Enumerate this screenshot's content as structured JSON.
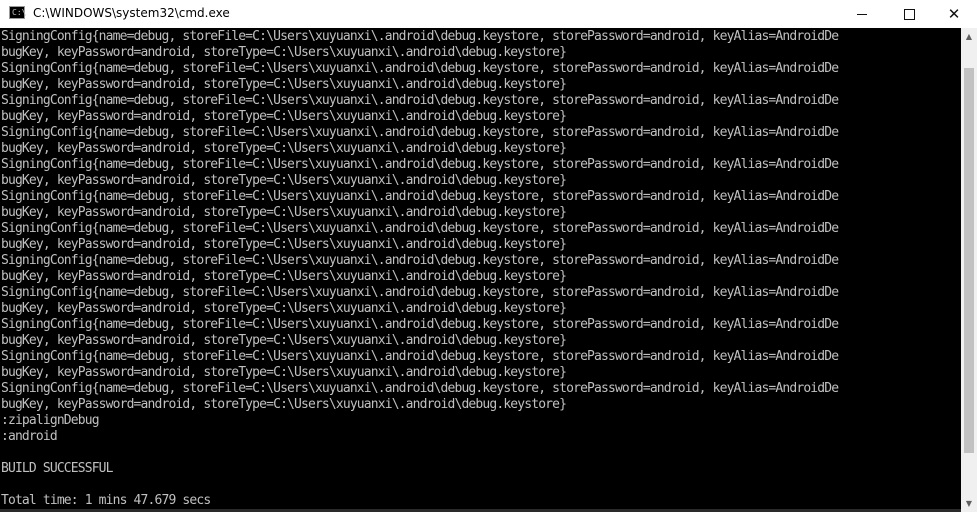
{
  "window": {
    "title": "C:\\WINDOWS\\system32\\cmd.exe",
    "icon_name": "cmd-icon",
    "icon_text": "C:\\"
  },
  "scrollbar": {
    "thumb_start_fraction": 0.05,
    "thumb_end_fraction": 0.91
  },
  "console": {
    "lines": [
      "SigningConfig{name=debug, storeFile=C:\\Users\\xuyuanxi\\.android\\debug.keystore, storePassword=android, keyAlias=AndroidDe",
      "bugKey, keyPassword=android, storeType=C:\\Users\\xuyuanxi\\.android\\debug.keystore}",
      "SigningConfig{name=debug, storeFile=C:\\Users\\xuyuanxi\\.android\\debug.keystore, storePassword=android, keyAlias=AndroidDe",
      "bugKey, keyPassword=android, storeType=C:\\Users\\xuyuanxi\\.android\\debug.keystore}",
      "SigningConfig{name=debug, storeFile=C:\\Users\\xuyuanxi\\.android\\debug.keystore, storePassword=android, keyAlias=AndroidDe",
      "bugKey, keyPassword=android, storeType=C:\\Users\\xuyuanxi\\.android\\debug.keystore}",
      "SigningConfig{name=debug, storeFile=C:\\Users\\xuyuanxi\\.android\\debug.keystore, storePassword=android, keyAlias=AndroidDe",
      "bugKey, keyPassword=android, storeType=C:\\Users\\xuyuanxi\\.android\\debug.keystore}",
      "SigningConfig{name=debug, storeFile=C:\\Users\\xuyuanxi\\.android\\debug.keystore, storePassword=android, keyAlias=AndroidDe",
      "bugKey, keyPassword=android, storeType=C:\\Users\\xuyuanxi\\.android\\debug.keystore}",
      "SigningConfig{name=debug, storeFile=C:\\Users\\xuyuanxi\\.android\\debug.keystore, storePassword=android, keyAlias=AndroidDe",
      "bugKey, keyPassword=android, storeType=C:\\Users\\xuyuanxi\\.android\\debug.keystore}",
      "SigningConfig{name=debug, storeFile=C:\\Users\\xuyuanxi\\.android\\debug.keystore, storePassword=android, keyAlias=AndroidDe",
      "bugKey, keyPassword=android, storeType=C:\\Users\\xuyuanxi\\.android\\debug.keystore}",
      "SigningConfig{name=debug, storeFile=C:\\Users\\xuyuanxi\\.android\\debug.keystore, storePassword=android, keyAlias=AndroidDe",
      "bugKey, keyPassword=android, storeType=C:\\Users\\xuyuanxi\\.android\\debug.keystore}",
      "SigningConfig{name=debug, storeFile=C:\\Users\\xuyuanxi\\.android\\debug.keystore, storePassword=android, keyAlias=AndroidDe",
      "bugKey, keyPassword=android, storeType=C:\\Users\\xuyuanxi\\.android\\debug.keystore}",
      "SigningConfig{name=debug, storeFile=C:\\Users\\xuyuanxi\\.android\\debug.keystore, storePassword=android, keyAlias=AndroidDe",
      "bugKey, keyPassword=android, storeType=C:\\Users\\xuyuanxi\\.android\\debug.keystore}",
      "SigningConfig{name=debug, storeFile=C:\\Users\\xuyuanxi\\.android\\debug.keystore, storePassword=android, keyAlias=AndroidDe",
      "bugKey, keyPassword=android, storeType=C:\\Users\\xuyuanxi\\.android\\debug.keystore}",
      "SigningConfig{name=debug, storeFile=C:\\Users\\xuyuanxi\\.android\\debug.keystore, storePassword=android, keyAlias=AndroidDe",
      "bugKey, keyPassword=android, storeType=C:\\Users\\xuyuanxi\\.android\\debug.keystore}",
      ":zipalignDebug",
      ":android",
      "",
      "BUILD SUCCESSFUL",
      "",
      "Total time: 1 mins 47.679 secs"
    ]
  }
}
